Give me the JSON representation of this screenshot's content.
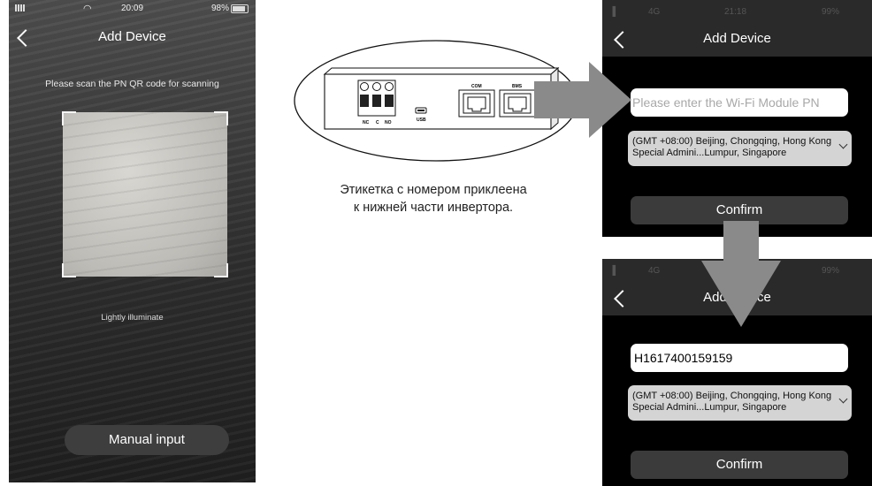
{
  "scanner_screen": {
    "status": {
      "time": "20:09",
      "battery": "98%"
    },
    "title": "Add Device",
    "hint": "Please scan the PN QR code for scanning",
    "light_label": "Lightly illuminate",
    "manual_button": "Manual input"
  },
  "diagram": {
    "terminal_labels": [
      "NC",
      "C",
      "NO"
    ],
    "usb_label": "USB",
    "com_label": "COM",
    "bms_label": "BMS",
    "caption_line1": "Этикетка с номером приклеена",
    "caption_line2": "к нижней части инвертора."
  },
  "input_screen": {
    "status": {
      "network": "4G",
      "time": "21:18",
      "battery": "99%"
    },
    "title": "Add Device",
    "pn_placeholder": "Please enter the Wi-Fi Module PN",
    "timezone": "(GMT +08:00) Beijing, Chongqing, Hong Kong Special Admini...Lumpur, Singapore",
    "confirm_label": "Confirm"
  },
  "filled_screen": {
    "status": {
      "network": "4G",
      "battery": "99%"
    },
    "title": "Add Device",
    "pn_value": "H1617400159159",
    "timezone": "(GMT +08:00) Beijing, Chongqing, Hong Kong Special Admini...Lumpur, Singapore",
    "confirm_label": "Confirm"
  },
  "colors": {
    "arrow": "#8a8a8a",
    "button_dark": "#3b3b3b"
  }
}
